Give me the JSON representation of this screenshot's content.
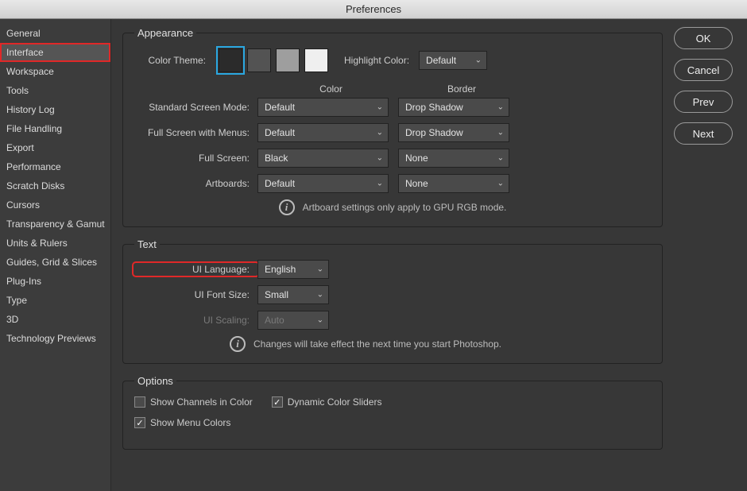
{
  "window": {
    "title": "Preferences"
  },
  "sidebar": {
    "items": [
      "General",
      "Interface",
      "Workspace",
      "Tools",
      "History Log",
      "File Handling",
      "Export",
      "Performance",
      "Scratch Disks",
      "Cursors",
      "Transparency & Gamut",
      "Units & Rulers",
      "Guides, Grid & Slices",
      "Plug-Ins",
      "Type",
      "3D",
      "Technology Previews"
    ],
    "selected_index": 1
  },
  "buttons": {
    "ok": "OK",
    "cancel": "Cancel",
    "prev": "Prev",
    "next": "Next"
  },
  "appearance": {
    "legend": "Appearance",
    "color_theme_label": "Color Theme:",
    "swatches": [
      "#2b2b2b",
      "#535353",
      "#9e9e9e",
      "#efefef"
    ],
    "selected_swatch": 0,
    "highlight_label": "Highlight Color:",
    "highlight_value": "Default",
    "grid": {
      "hdr_color": "Color",
      "hdr_border": "Border",
      "rows": [
        {
          "label": "Standard Screen Mode:",
          "color": "Default",
          "border": "Drop Shadow"
        },
        {
          "label": "Full Screen with Menus:",
          "color": "Default",
          "border": "Drop Shadow"
        },
        {
          "label": "Full Screen:",
          "color": "Black",
          "border": "None"
        },
        {
          "label": "Artboards:",
          "color": "Default",
          "border": "None"
        }
      ]
    },
    "info_text": "Artboard settings only apply to GPU RGB mode."
  },
  "text": {
    "legend": "Text",
    "lang_label": "UI Language:",
    "lang_value": "English",
    "font_label": "UI Font Size:",
    "font_value": "Small",
    "scaling_label": "UI Scaling:",
    "scaling_value": "Auto",
    "info_text": "Changes will take effect the next time you start Photoshop."
  },
  "options": {
    "legend": "Options",
    "chk1": {
      "label": "Show Channels in Color",
      "checked": false
    },
    "chk2": {
      "label": "Dynamic Color Sliders",
      "checked": true
    },
    "chk3": {
      "label": "Show Menu Colors",
      "checked": true
    }
  }
}
